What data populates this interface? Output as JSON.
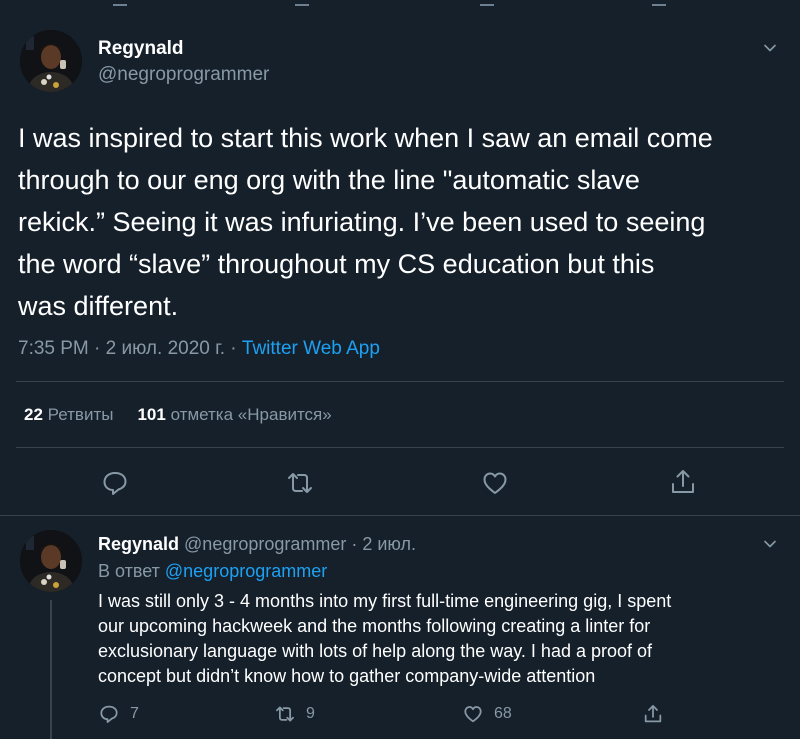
{
  "tweet": {
    "author_name": "Regynald",
    "author_handle": "@negroprogrammer",
    "text": "I was inspired to start this work when I saw an email come\nthrough to our eng org with the line \"automatic slave\nrekick.” Seeing it was infuriating. I’ve been used to seeing\nthe word “slave” throughout my CS education but this\nwas different.",
    "time": "7:35 PM · 2 июл. 2020 г. · ",
    "source": "Twitter Web App",
    "retweets_count": "22",
    "retweets_label": "Ретвиты",
    "likes_count": "101",
    "likes_label": "отметка «Нравится»"
  },
  "reply": {
    "author_name": "Regynald",
    "handle_date": " @negroprogrammer · 2 июл.",
    "reply_prefix": "В ответ ",
    "reply_mention": "@negroprogrammer",
    "text": "I was still only 3 - 4 months into my first full-time engineering gig, I spent\nour upcoming hackweek and the months following creating a linter for\nexclusionary language with lots of help along the way. I had a proof of\nconcept but didn’t know how to gather company-wide attention",
    "reply_count": "7",
    "retweet_count": "9",
    "like_count": "68"
  },
  "icons": {
    "reply": "comment-icon",
    "retweet": "retweet-icon",
    "like": "heart-icon",
    "share": "share-icon",
    "more": "chevron-down-icon"
  },
  "colors": {
    "background": "#15202b",
    "muted": "#8899a6",
    "accent": "#1da1f2",
    "divider": "#38444d"
  }
}
